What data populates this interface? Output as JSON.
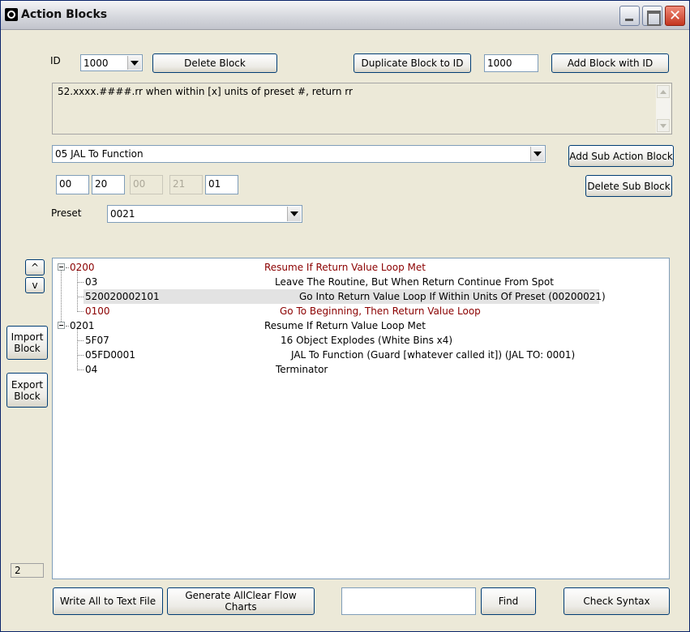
{
  "window": {
    "title": "Action Blocks"
  },
  "id_label": "ID",
  "id_select": "1000",
  "delete_block": "Delete Block",
  "duplicate_block": "Duplicate Block to ID",
  "duplicate_id": "1000",
  "add_block": "Add Block with ID",
  "description": "52.xxxx.####.rr when within [x] units of preset #, return rr",
  "sub_action_select": "05 JAL To Function",
  "add_sub_action": "Add Sub Action Block",
  "delete_sub_block": "Delete Sub Block",
  "params": [
    {
      "value": "00",
      "disabled": false
    },
    {
      "value": "20",
      "disabled": false
    },
    {
      "value": "00",
      "disabled": true
    },
    {
      "value": "21",
      "disabled": true
    },
    {
      "value": "01",
      "disabled": false
    }
  ],
  "preset_label": "Preset",
  "preset_select": "0021",
  "move_up": "^",
  "move_down": "v",
  "import_block": "Import Block",
  "export_block": "Export Block",
  "tree": [
    {
      "code": "0200",
      "text": "Resume If Return Value Loop Met",
      "level": 0,
      "red": true
    },
    {
      "code": "03",
      "text": "Leave The Routine, But When Return Continue From Spot",
      "level": 1,
      "red": false
    },
    {
      "code": "520020002101",
      "text": "Go Into Return Value Loop If Within Units Of Preset (00200021)",
      "level": 1,
      "red": false,
      "selected": true
    },
    {
      "code": "0100",
      "text": "Go To Beginning, Then Return Value Loop",
      "level": 1,
      "red": true
    },
    {
      "code": "0201",
      "text": "Resume If Return Value Loop Met",
      "level": 0,
      "red": false
    },
    {
      "code": "5F07",
      "text": "16 Object Explodes (White Bins x4)",
      "level": 1,
      "red": false
    },
    {
      "code": "05FD0001",
      "text": "JAL To Function (Guard [whatever called it]) (JAL TO: 0001)",
      "level": 1,
      "red": false
    },
    {
      "code": "04",
      "text": "Terminator",
      "level": 1,
      "red": false
    }
  ],
  "status_count": "2",
  "write_all": "Write All to Text File",
  "generate_flow": "Generate AllClear Flow Charts",
  "find_input": "",
  "find": "Find",
  "check_syntax": "Check Syntax"
}
